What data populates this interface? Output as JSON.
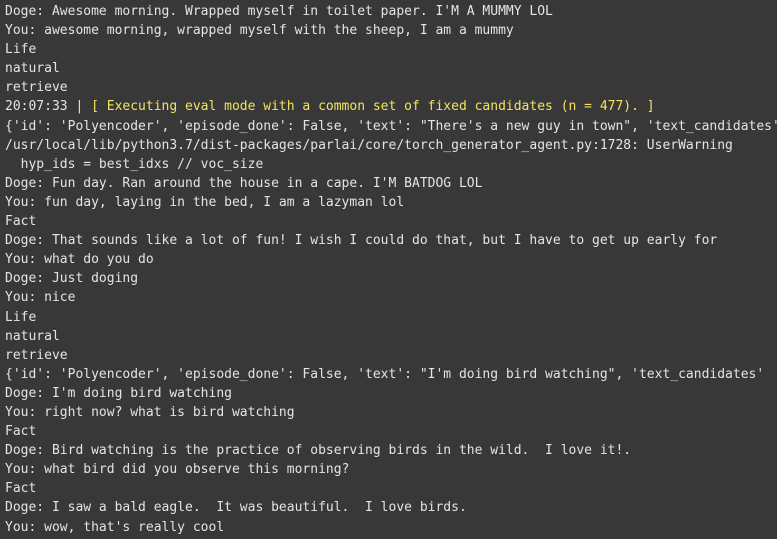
{
  "console": {
    "lines": [
      "Doge: Awesome morning. Wrapped myself in toilet paper. I'M A MUMMY LOL",
      "You: awesome morning, wrapped myself with the sheep, I am a mummy",
      "Life",
      "natural",
      "retrieve",
      null,
      "{'id': 'Polyencoder', 'episode_done': False, 'text': \"There's a new guy in town\", 'text_candidates': ",
      "/usr/local/lib/python3.7/dist-packages/parlai/core/torch_generator_agent.py:1728: UserWarning",
      "  hyp_ids = best_idxs // voc_size",
      "Doge: Fun day. Ran around the house in a cape. I'M BATDOG LOL",
      "You: fun day, laying in the bed, I am a lazyman lol",
      "Fact",
      "Doge: That sounds like a lot of fun! I wish I could do that, but I have to get up early for",
      "You: what do you do",
      "Doge: Just doging",
      "You: nice",
      "Life",
      "natural",
      "retrieve",
      "{'id': 'Polyencoder', 'episode_done': False, 'text': \"I'm doing bird watching\", 'text_candidates'",
      "Doge: I'm doing bird watching",
      "You: right now? what is bird watching",
      "Fact",
      "Doge: Bird watching is the practice of observing birds in the wild.  I love it!.",
      "You: what bird did you observe this morning?",
      "Fact",
      "Doge: I saw a bald eagle.  It was beautiful.  I love birds.",
      "You: wow, that's really cool"
    ],
    "log_line": {
      "timestamp": "20:07:33 | ",
      "message": "[ Executing eval mode with a common set of fixed candidates (n = 477). ]"
    },
    "colors": {
      "background": "#383838",
      "text": "#e4e4e4",
      "highlight": "#f3e45d"
    }
  }
}
